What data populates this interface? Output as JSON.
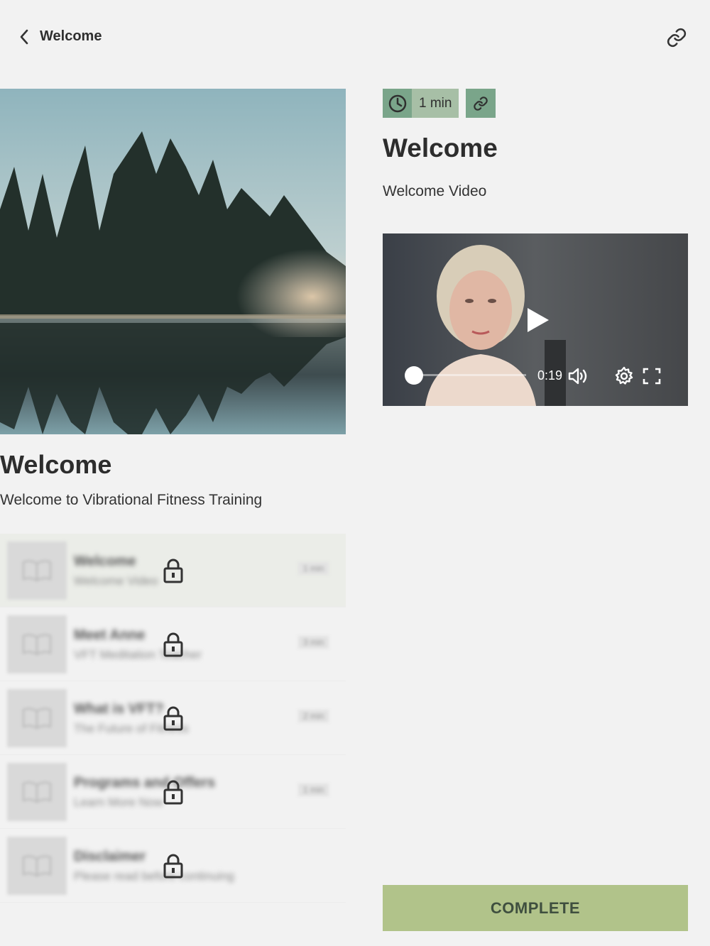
{
  "header": {
    "title": "Welcome",
    "back_icon": "chevron-left-icon",
    "share_icon": "link-icon"
  },
  "course": {
    "title": "Welcome",
    "subtitle": "Welcome to Vibrational Fitness Training",
    "cover_image": "misty lake with pine trees"
  },
  "lessons": [
    {
      "name": "Welcome",
      "description": "Welcome Video",
      "duration": "1 min",
      "locked": true,
      "active": true
    },
    {
      "name": "Meet Anne",
      "description": "VFT Meditation Teacher",
      "duration": "3 min",
      "locked": true,
      "active": false
    },
    {
      "name": "What is VFT?",
      "description": "The Future of Fitness",
      "duration": "2 min",
      "locked": true,
      "active": false
    },
    {
      "name": "Programs and Offers",
      "description": "Learn More Now",
      "duration": "1 min",
      "locked": true,
      "active": false
    },
    {
      "name": "Disclaimer",
      "description": "Please read before continuing",
      "duration": "",
      "locked": true,
      "active": false
    }
  ],
  "lesson_detail": {
    "duration": "1 min",
    "title": "Welcome",
    "subtitle": "Welcome Video"
  },
  "video": {
    "time": "0:19",
    "progress": 0.0
  },
  "complete_button": "COMPLETE",
  "colors": {
    "background": "#f2f2f2",
    "badge_dark": "#7aa58a",
    "badge_light": "#a7bfa6",
    "complete_button": "#b1c38a"
  }
}
